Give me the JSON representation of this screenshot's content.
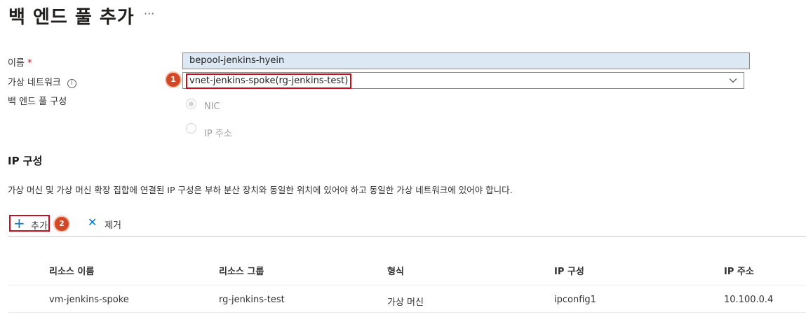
{
  "header": {
    "title": "백 엔드 풀 추가",
    "more": "···"
  },
  "form": {
    "name_label": "이름",
    "required_mark": "*",
    "name_value": "bepool-jenkins-hyein",
    "vnet_label": "가상 네트워크",
    "vnet_info_icon": "info-icon",
    "vnet_value": "vnet-jenkins-spoke(rg-jenkins-test)",
    "config_label": "백 엔드 풀 구성",
    "config_options": [
      {
        "label": "NIC",
        "selected": true,
        "disabled": true
      },
      {
        "label": "IP 주소",
        "selected": false,
        "disabled": true
      }
    ]
  },
  "ip_config": {
    "title": "IP 구성",
    "description": "가상 머신 및 가상 머신 확장 집합에 연결된 IP 구성은 부하 분산 장치와 동일한 위치에 있어야 하고 동일한 가상 네트워크에 있어야 합니다.",
    "toolbar": {
      "add_label": "추가",
      "remove_label": "제거"
    },
    "table": {
      "headers": [
        "리소스 이름",
        "리소스 그룹",
        "형식",
        "IP 구성",
        "IP 주소"
      ],
      "rows": [
        [
          "vm-jenkins-spoke",
          "rg-jenkins-test",
          "가상 머신",
          "ipconfig1",
          "10.100.0.4"
        ]
      ]
    }
  },
  "annotations": {
    "badge1": "1",
    "badge2": "2",
    "highlight_color": "#c50f1f",
    "badge_color": "#d24726"
  },
  "colors": {
    "accent": "#0078d4",
    "input_fill": "#dde8f5"
  }
}
